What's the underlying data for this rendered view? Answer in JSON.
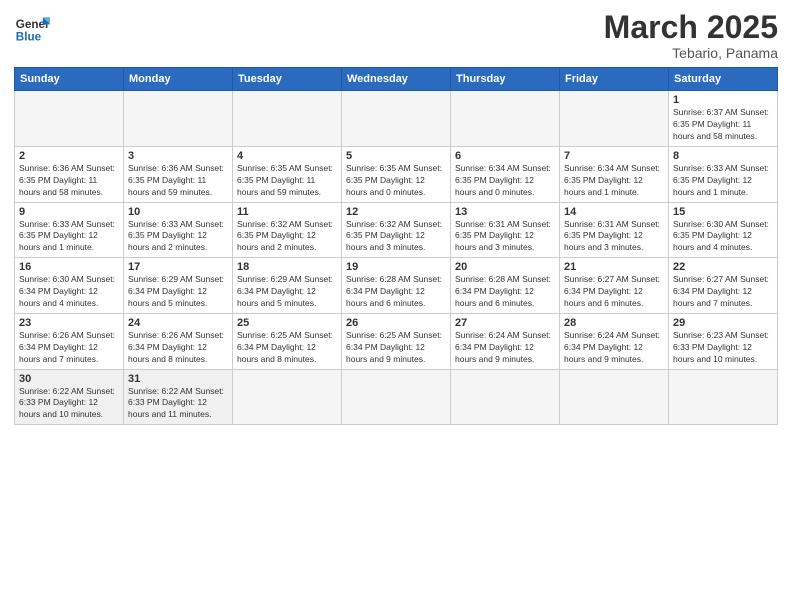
{
  "header": {
    "logo_general": "General",
    "logo_blue": "Blue",
    "month_title": "March 2025",
    "location": "Tebario, Panama"
  },
  "days_of_week": [
    "Sunday",
    "Monday",
    "Tuesday",
    "Wednesday",
    "Thursday",
    "Friday",
    "Saturday"
  ],
  "weeks": [
    [
      {
        "day": "",
        "info": ""
      },
      {
        "day": "",
        "info": ""
      },
      {
        "day": "",
        "info": ""
      },
      {
        "day": "",
        "info": ""
      },
      {
        "day": "",
        "info": ""
      },
      {
        "day": "",
        "info": ""
      },
      {
        "day": "1",
        "info": "Sunrise: 6:37 AM\nSunset: 6:35 PM\nDaylight: 11 hours\nand 58 minutes."
      }
    ],
    [
      {
        "day": "2",
        "info": "Sunrise: 6:36 AM\nSunset: 6:35 PM\nDaylight: 11 hours\nand 58 minutes."
      },
      {
        "day": "3",
        "info": "Sunrise: 6:36 AM\nSunset: 6:35 PM\nDaylight: 11 hours\nand 59 minutes."
      },
      {
        "day": "4",
        "info": "Sunrise: 6:35 AM\nSunset: 6:35 PM\nDaylight: 11 hours\nand 59 minutes."
      },
      {
        "day": "5",
        "info": "Sunrise: 6:35 AM\nSunset: 6:35 PM\nDaylight: 12 hours\nand 0 minutes."
      },
      {
        "day": "6",
        "info": "Sunrise: 6:34 AM\nSunset: 6:35 PM\nDaylight: 12 hours\nand 0 minutes."
      },
      {
        "day": "7",
        "info": "Sunrise: 6:34 AM\nSunset: 6:35 PM\nDaylight: 12 hours\nand 1 minute."
      },
      {
        "day": "8",
        "info": "Sunrise: 6:33 AM\nSunset: 6:35 PM\nDaylight: 12 hours\nand 1 minute."
      }
    ],
    [
      {
        "day": "9",
        "info": "Sunrise: 6:33 AM\nSunset: 6:35 PM\nDaylight: 12 hours\nand 1 minute."
      },
      {
        "day": "10",
        "info": "Sunrise: 6:33 AM\nSunset: 6:35 PM\nDaylight: 12 hours\nand 2 minutes."
      },
      {
        "day": "11",
        "info": "Sunrise: 6:32 AM\nSunset: 6:35 PM\nDaylight: 12 hours\nand 2 minutes."
      },
      {
        "day": "12",
        "info": "Sunrise: 6:32 AM\nSunset: 6:35 PM\nDaylight: 12 hours\nand 3 minutes."
      },
      {
        "day": "13",
        "info": "Sunrise: 6:31 AM\nSunset: 6:35 PM\nDaylight: 12 hours\nand 3 minutes."
      },
      {
        "day": "14",
        "info": "Sunrise: 6:31 AM\nSunset: 6:35 PM\nDaylight: 12 hours\nand 3 minutes."
      },
      {
        "day": "15",
        "info": "Sunrise: 6:30 AM\nSunset: 6:35 PM\nDaylight: 12 hours\nand 4 minutes."
      }
    ],
    [
      {
        "day": "16",
        "info": "Sunrise: 6:30 AM\nSunset: 6:34 PM\nDaylight: 12 hours\nand 4 minutes."
      },
      {
        "day": "17",
        "info": "Sunrise: 6:29 AM\nSunset: 6:34 PM\nDaylight: 12 hours\nand 5 minutes."
      },
      {
        "day": "18",
        "info": "Sunrise: 6:29 AM\nSunset: 6:34 PM\nDaylight: 12 hours\nand 5 minutes."
      },
      {
        "day": "19",
        "info": "Sunrise: 6:28 AM\nSunset: 6:34 PM\nDaylight: 12 hours\nand 6 minutes."
      },
      {
        "day": "20",
        "info": "Sunrise: 6:28 AM\nSunset: 6:34 PM\nDaylight: 12 hours\nand 6 minutes."
      },
      {
        "day": "21",
        "info": "Sunrise: 6:27 AM\nSunset: 6:34 PM\nDaylight: 12 hours\nand 6 minutes."
      },
      {
        "day": "22",
        "info": "Sunrise: 6:27 AM\nSunset: 6:34 PM\nDaylight: 12 hours\nand 7 minutes."
      }
    ],
    [
      {
        "day": "23",
        "info": "Sunrise: 6:26 AM\nSunset: 6:34 PM\nDaylight: 12 hours\nand 7 minutes."
      },
      {
        "day": "24",
        "info": "Sunrise: 6:26 AM\nSunset: 6:34 PM\nDaylight: 12 hours\nand 8 minutes."
      },
      {
        "day": "25",
        "info": "Sunrise: 6:25 AM\nSunset: 6:34 PM\nDaylight: 12 hours\nand 8 minutes."
      },
      {
        "day": "26",
        "info": "Sunrise: 6:25 AM\nSunset: 6:34 PM\nDaylight: 12 hours\nand 9 minutes."
      },
      {
        "day": "27",
        "info": "Sunrise: 6:24 AM\nSunset: 6:34 PM\nDaylight: 12 hours\nand 9 minutes."
      },
      {
        "day": "28",
        "info": "Sunrise: 6:24 AM\nSunset: 6:34 PM\nDaylight: 12 hours\nand 9 minutes."
      },
      {
        "day": "29",
        "info": "Sunrise: 6:23 AM\nSunset: 6:33 PM\nDaylight: 12 hours\nand 10 minutes."
      }
    ],
    [
      {
        "day": "30",
        "info": "Sunrise: 6:22 AM\nSunset: 6:33 PM\nDaylight: 12 hours\nand 10 minutes."
      },
      {
        "day": "31",
        "info": "Sunrise: 6:22 AM\nSunset: 6:33 PM\nDaylight: 12 hours\nand 11 minutes."
      },
      {
        "day": "",
        "info": ""
      },
      {
        "day": "",
        "info": ""
      },
      {
        "day": "",
        "info": ""
      },
      {
        "day": "",
        "info": ""
      },
      {
        "day": "",
        "info": ""
      }
    ]
  ]
}
